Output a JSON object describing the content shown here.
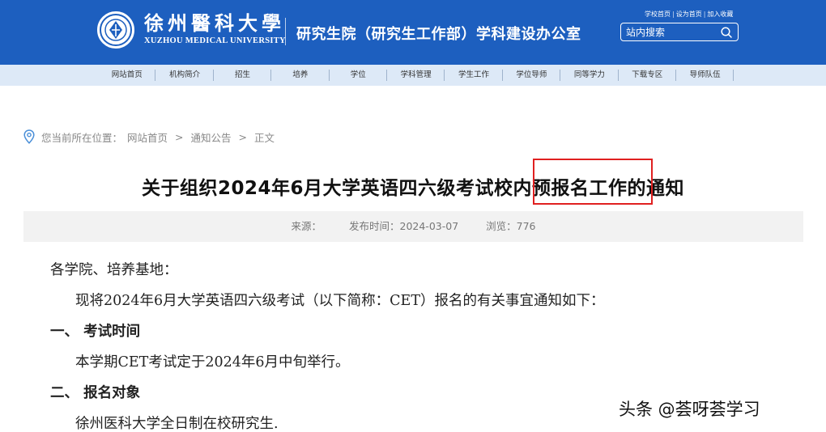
{
  "header": {
    "logo_cn": "徐州醫科大學",
    "logo_en": "XUZHOU MEDICAL UNIVERSITY",
    "office_title": "研究生院（研究生工作部）学科建设办公室",
    "top_links": [
      "学校首页",
      "设为首页",
      "加入收藏"
    ],
    "search": {
      "placeholder": "站内搜索"
    },
    "brand_color": "#1d5fbf"
  },
  "nav": {
    "items": [
      "网站首页",
      "机构简介",
      "招生",
      "培养",
      "学位",
      "学科管理",
      "学生工作",
      "学位导师",
      "同等学力",
      "下载专区",
      "导师队伍"
    ]
  },
  "breadcrumb": {
    "prefix": "您当前所在位置：",
    "home": "网站首页",
    "section": "通知公告",
    "current": "正文",
    "separator": ">"
  },
  "article": {
    "title": "关于组织2024年6月大学英语四六级考试校内预报名工作的通知",
    "meta": {
      "source_label": "来源：",
      "source_value": "",
      "date_label": "发布时间：",
      "date_value": "2024-03-07",
      "views_label": "浏览：",
      "views_value": "776"
    },
    "content": {
      "greeting": "各学院、培养基地：",
      "intro": "现将2024年6月大学英语四六级考试（以下简称：CET）报名的有关事宜通知如下：",
      "section1_heading": "一、  考试时间",
      "section1_text": "本学期CET考试定于2024年6月中旬举行。",
      "section2_heading": "二、  报名对象",
      "section2_text": "徐州医科大学全日制在校研究生."
    }
  },
  "watermark": "头条 @荟呀荟学习",
  "highlight_color": "#e02020"
}
